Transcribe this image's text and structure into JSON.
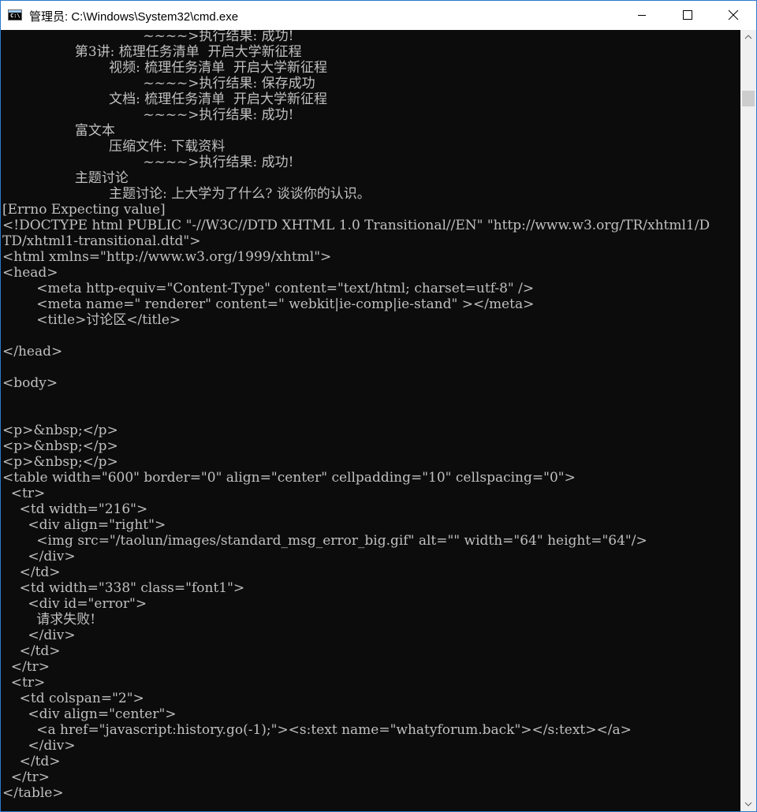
{
  "window": {
    "title": "管理员: C:\\Windows\\System32\\cmd.exe",
    "icon": "cmd-console-icon",
    "controls": {
      "minimize": "minimize-icon",
      "maximize": "maximize-icon",
      "close": "close-icon"
    }
  },
  "console": {
    "colors": {
      "background": "#0c0c0c",
      "text": "#c0c0c0"
    },
    "lines": [
      "                                 ~~~~>执行结果: 成功!",
      "                 第3讲: 梳理任务清单  开启大学新征程",
      "                         视频: 梳理任务清单  开启大学新征程",
      "                                 ~~~~>执行结果: 保存成功",
      "                         文档: 梳理任务清单  开启大学新征程",
      "                                 ~~~~>执行结果: 成功!",
      "                 富文本",
      "                         压缩文件: 下载资料",
      "                                 ~~~~>执行结果: 成功!",
      "                 主题讨论",
      "                         主题讨论: 上大学为了什么? 谈谈你的认识。",
      "[Errno Expecting value]",
      "<!DOCTYPE html PUBLIC \"-//W3C//DTD XHTML 1.0 Transitional//EN\" \"http://www.w3.org/TR/xhtml1/D",
      "TD/xhtml1-transitional.dtd\">",
      "<html xmlns=\"http://www.w3.org/1999/xhtml\">",
      "<head>",
      "        <meta http-equiv=\"Content-Type\" content=\"text/html; charset=utf-8\" />",
      "        <meta name=\" renderer\" content=\" webkit|ie-comp|ie-stand\" ></meta>",
      "        <title>讨论区</title>",
      "",
      "</head>",
      "",
      "<body>",
      "",
      "",
      "<p>&nbsp;</p>",
      "<p>&nbsp;</p>",
      "<p>&nbsp;</p>",
      "<table width=\"600\" border=\"0\" align=\"center\" cellpadding=\"10\" cellspacing=\"0\">",
      "  <tr>",
      "    <td width=\"216\">",
      "      <div align=\"right\">",
      "        <img src=\"/taolun/images/standard_msg_error_big.gif\" alt=\"\" width=\"64\" height=\"64\"/>",
      "      </div>",
      "    </td>",
      "    <td width=\"338\" class=\"font1\">",
      "      <div id=\"error\">",
      "        请求失败!",
      "      </div>",
      "    </td>",
      "  </tr>",
      "  <tr>",
      "    <td colspan=\"2\">",
      "      <div align=\"center\">",
      "        <a href=\"javascript:history.go(-1);\"><s:text name=\"whatyforum.back\"></s:text></a>",
      "      </div>",
      "    </td>",
      "  </tr>",
      "</table>"
    ]
  },
  "scrollbar": {
    "up_icon": "scroll-up-arrow-icon",
    "down_icon": "scroll-down-arrow-icon"
  }
}
